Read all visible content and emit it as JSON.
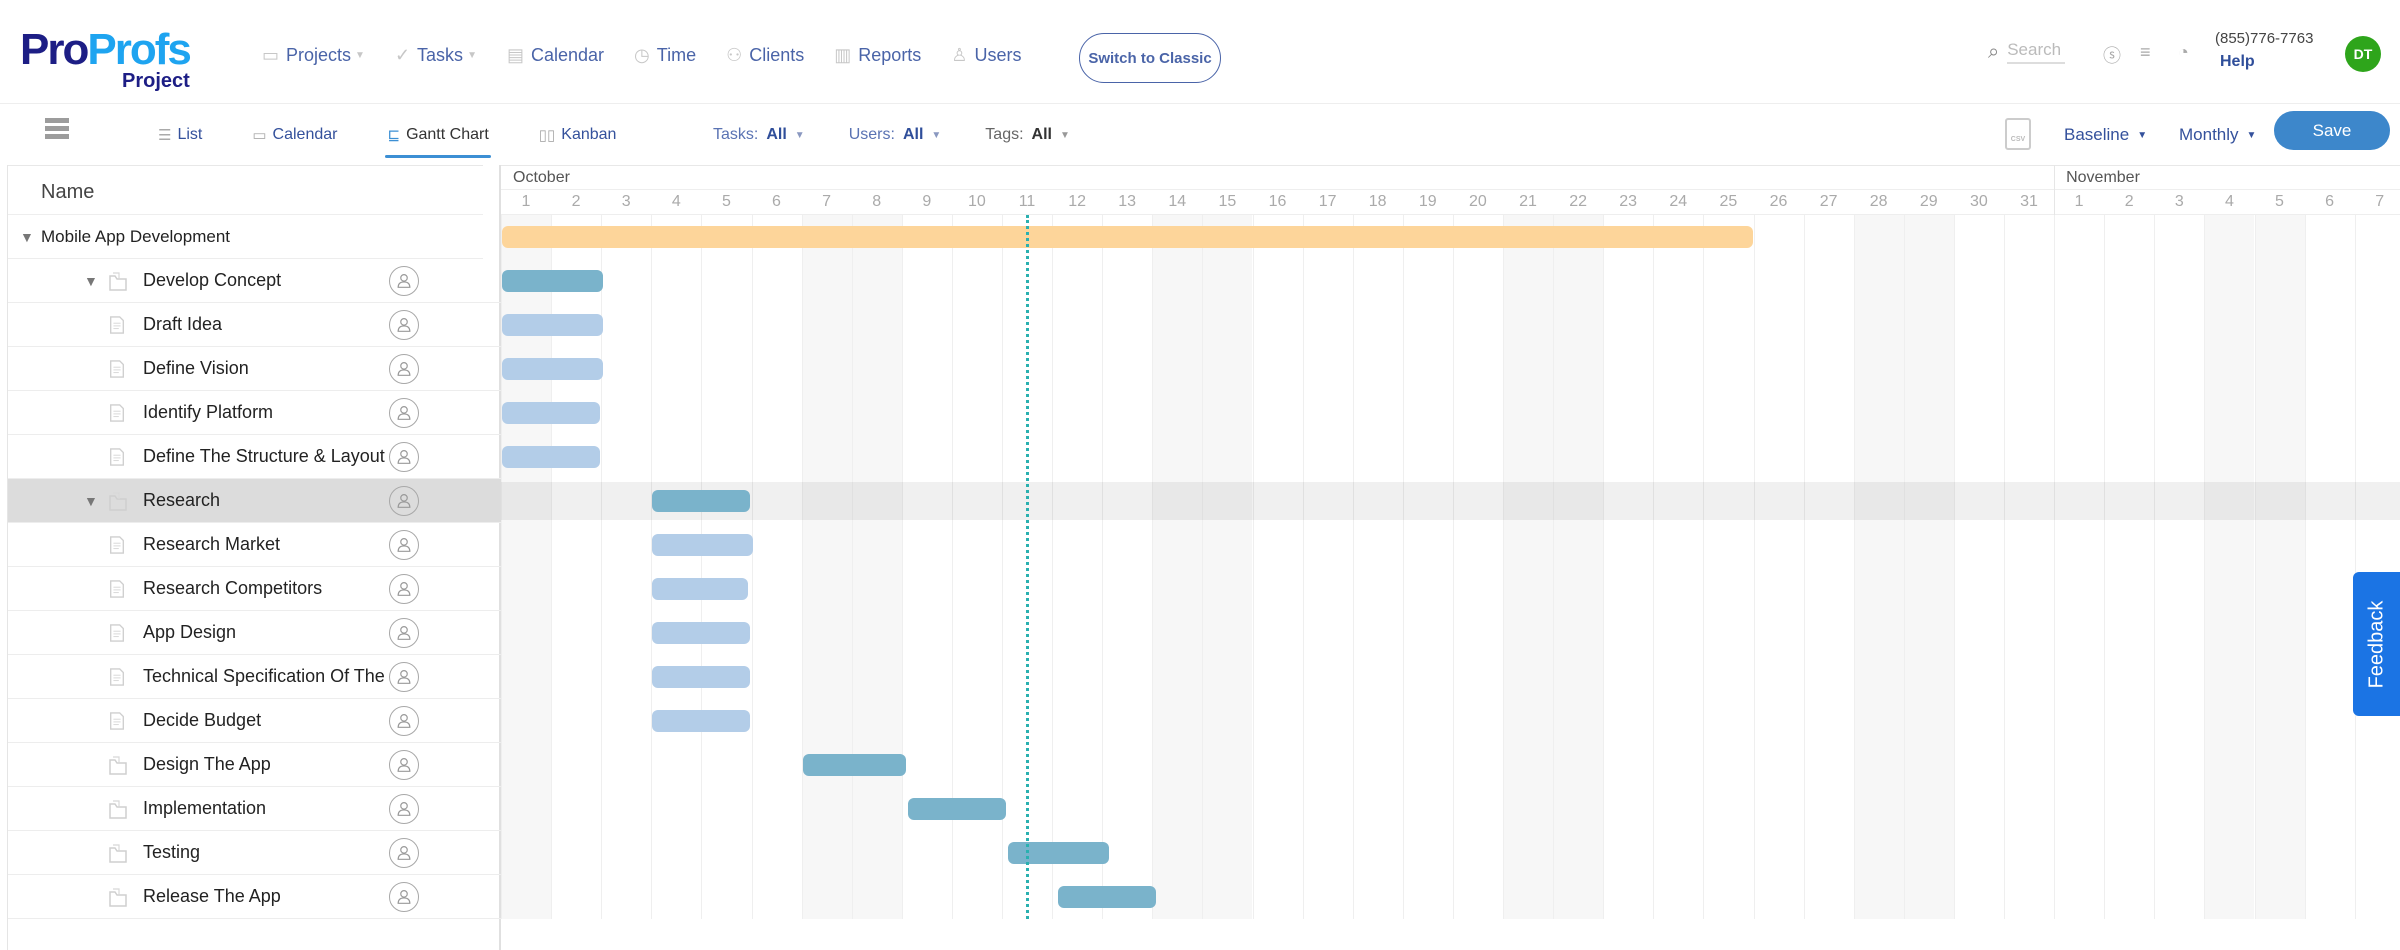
{
  "logo": {
    "main_a": "Pro",
    "main_b": "Profs",
    "sub": "Project"
  },
  "nav": [
    {
      "label": "Projects",
      "icon": "briefcase-icon",
      "glyph": "▭",
      "dropdown": true
    },
    {
      "label": "Tasks",
      "icon": "check-circle-icon",
      "glyph": "✓",
      "dropdown": true
    },
    {
      "label": "Calendar",
      "icon": "calendar-icon",
      "glyph": "▤",
      "dropdown": false
    },
    {
      "label": "Time",
      "icon": "clock-icon",
      "glyph": "◷",
      "dropdown": false
    },
    {
      "label": "Clients",
      "icon": "clients-icon",
      "glyph": "⚇",
      "dropdown": false
    },
    {
      "label": "Reports",
      "icon": "bar-chart-icon",
      "glyph": "▥",
      "dropdown": false
    },
    {
      "label": "Users",
      "icon": "user-icon",
      "glyph": "♙",
      "dropdown": false
    }
  ],
  "switch_classic": "Switch to Classic",
  "header_right": {
    "search_placeholder": "Search",
    "phone": "(855)776-7763",
    "help": "Help",
    "avatar_initials": "DT",
    "avatar_color": "#2ea51b"
  },
  "views": [
    {
      "label": "List",
      "icon": "list-icon",
      "glyph": "☰",
      "active": false
    },
    {
      "label": "Calendar",
      "icon": "calendar-icon",
      "glyph": "▭",
      "active": false
    },
    {
      "label": "Gantt Chart",
      "icon": "gantt-icon",
      "glyph": "⊑",
      "active": true
    },
    {
      "label": "Kanban",
      "icon": "kanban-icon",
      "glyph": "▯▯",
      "active": false
    }
  ],
  "filters": {
    "tasks": {
      "label": "Tasks:",
      "value": "All"
    },
    "users": {
      "label": "Users:",
      "value": "All"
    },
    "tags": {
      "label": "Tags:",
      "value": "All"
    }
  },
  "toolbar": {
    "csv": "CSV",
    "baseline": "Baseline",
    "period": "Monthly",
    "save": "Save"
  },
  "grid": {
    "name_header": "Name"
  },
  "feedback": "Feedback",
  "chart_data": {
    "type": "gantt",
    "months": [
      {
        "label": "October",
        "start_index": 0
      },
      {
        "label": "November",
        "start_index": 31
      }
    ],
    "days": [
      "1",
      "2",
      "3",
      "4",
      "5",
      "6",
      "7",
      "8",
      "9",
      "10",
      "11",
      "12",
      "13",
      "14",
      "15",
      "16",
      "17",
      "18",
      "19",
      "20",
      "21",
      "22",
      "23",
      "24",
      "25",
      "26",
      "27",
      "28",
      "29",
      "30",
      "31",
      "1",
      "2",
      "3",
      "4",
      "5",
      "6",
      "7"
    ],
    "weekend_indices": [
      0,
      6,
      7,
      13,
      14,
      20,
      21,
      27,
      28,
      34,
      35
    ],
    "today_index": 10.5,
    "colors": {
      "project": "#fdd59a",
      "group": "#7ab3cb",
      "task": "#b3cde8",
      "today": "#2ab0b0"
    },
    "rows": [
      {
        "name": "Mobile App Development",
        "level": 0,
        "kind": "project",
        "expanded": true,
        "start": 0,
        "end": 25
      },
      {
        "name": "Develop Concept",
        "level": 1,
        "kind": "group",
        "expanded": true,
        "start": 0,
        "end": 2.05
      },
      {
        "name": "Draft Idea",
        "level": 2,
        "kind": "task",
        "start": 0,
        "end": 2.05
      },
      {
        "name": "Define Vision",
        "level": 2,
        "kind": "task",
        "start": 0,
        "end": 2.05
      },
      {
        "name": "Identify Platform",
        "level": 2,
        "kind": "task",
        "start": 0,
        "end": 2
      },
      {
        "name": "Define The Structure & Layout of",
        "level": 2,
        "kind": "task",
        "start": 0,
        "end": 2
      },
      {
        "name": "Research",
        "level": 1,
        "kind": "group",
        "expanded": true,
        "selected": true,
        "start": 3,
        "end": 5
      },
      {
        "name": "Research Market",
        "level": 2,
        "kind": "task",
        "start": 3,
        "end": 5.05
      },
      {
        "name": "Research Competitors",
        "level": 2,
        "kind": "task",
        "start": 3,
        "end": 4.95
      },
      {
        "name": "App Design",
        "level": 2,
        "kind": "task",
        "start": 3,
        "end": 5
      },
      {
        "name": "Technical Specification Of The",
        "level": 2,
        "kind": "task",
        "start": 3,
        "end": 5
      },
      {
        "name": "Decide Budget",
        "level": 2,
        "kind": "task",
        "start": 3,
        "end": 5
      },
      {
        "name": "Design The App",
        "level": 1,
        "kind": "group",
        "start": 6,
        "end": 8.1
      },
      {
        "name": "Implementation",
        "level": 1,
        "kind": "group",
        "start": 8.1,
        "end": 10.1
      },
      {
        "name": "Testing",
        "level": 1,
        "kind": "group",
        "start": 10.1,
        "end": 12.15
      },
      {
        "name": "Release The App",
        "level": 1,
        "kind": "group",
        "start": 11.1,
        "end": 13.1
      }
    ]
  }
}
